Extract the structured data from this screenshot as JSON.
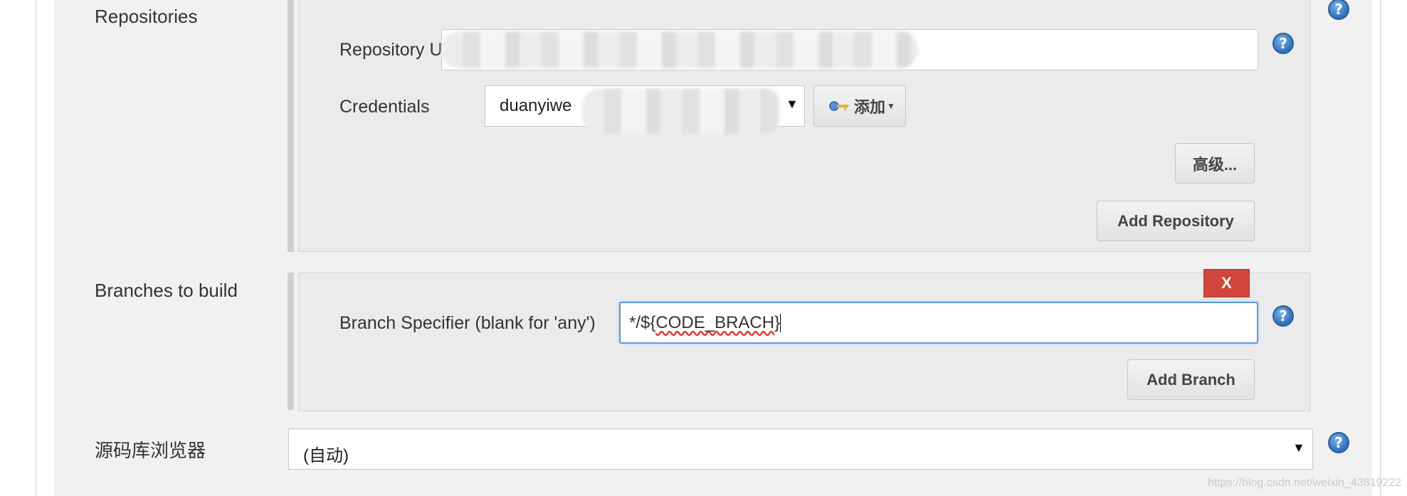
{
  "repositories": {
    "section_label": "Repositories",
    "repo_url_label": "Repository U",
    "credentials_label": "Credentials",
    "credentials_value": "duanyiwe",
    "add_credentials_label": "添加",
    "advanced_label": "高级...",
    "add_repository_label": "Add Repository"
  },
  "branches": {
    "section_label": "Branches to build",
    "branch_specifier_label": "Branch Specifier (blank for 'any')",
    "branch_value_prefix": "*/${",
    "branch_value_mid": "CODE_BRACH",
    "branch_value_suffix": "}",
    "delete_label": "X",
    "add_branch_label": "Add Branch"
  },
  "browser": {
    "section_label": "源码库浏览器",
    "selected_value": "(自动)"
  },
  "help_glyph": "?",
  "dropdown_caret": "▼",
  "watermark": "https://blog.csdn.net/weixin_43819222",
  "colors": {
    "delete_red": "#d0463b",
    "help_blue": "#2f6fb7",
    "focus_blue": "#5b9ad8"
  }
}
